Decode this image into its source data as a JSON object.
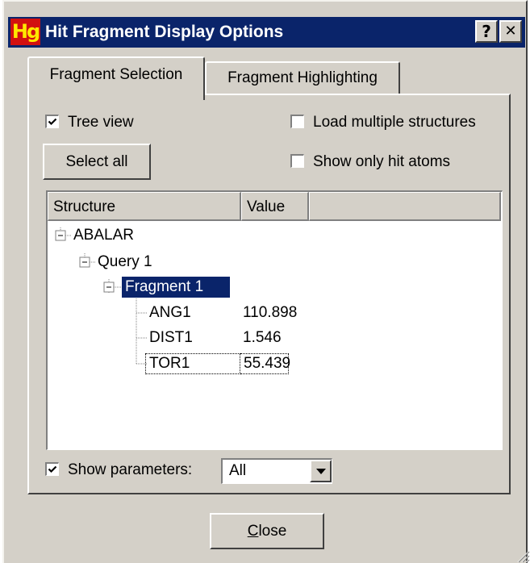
{
  "window": {
    "title": "Hit Fragment Display Options",
    "icon_text": "Hg",
    "help_label": "?",
    "close_label": "✕"
  },
  "tabs": [
    {
      "label": "Fragment Selection",
      "active": true
    },
    {
      "label": "Fragment Highlighting",
      "active": false
    }
  ],
  "options": {
    "tree_view": {
      "label": "Tree view",
      "checked": true
    },
    "load_multiple": {
      "label": "Load multiple structures",
      "checked": false
    },
    "show_only_hit_atoms": {
      "label": "Show only hit atoms",
      "checked": false
    },
    "select_all_label": "Select all"
  },
  "table": {
    "columns": [
      "Structure",
      "Value"
    ],
    "tree": {
      "root": "ABALAR",
      "query": "Query 1",
      "fragment": "Fragment 1",
      "params": [
        {
          "name": "ANG1",
          "value": "110.898"
        },
        {
          "name": "DIST1",
          "value": "1.546"
        },
        {
          "name": "TOR1",
          "value": "55.439"
        }
      ]
    }
  },
  "show_parameters": {
    "label": "Show parameters:",
    "checked": true,
    "selected": "All"
  },
  "footer": {
    "close_prefix": "",
    "close_mnemonic": "C",
    "close_rest": "lose"
  }
}
